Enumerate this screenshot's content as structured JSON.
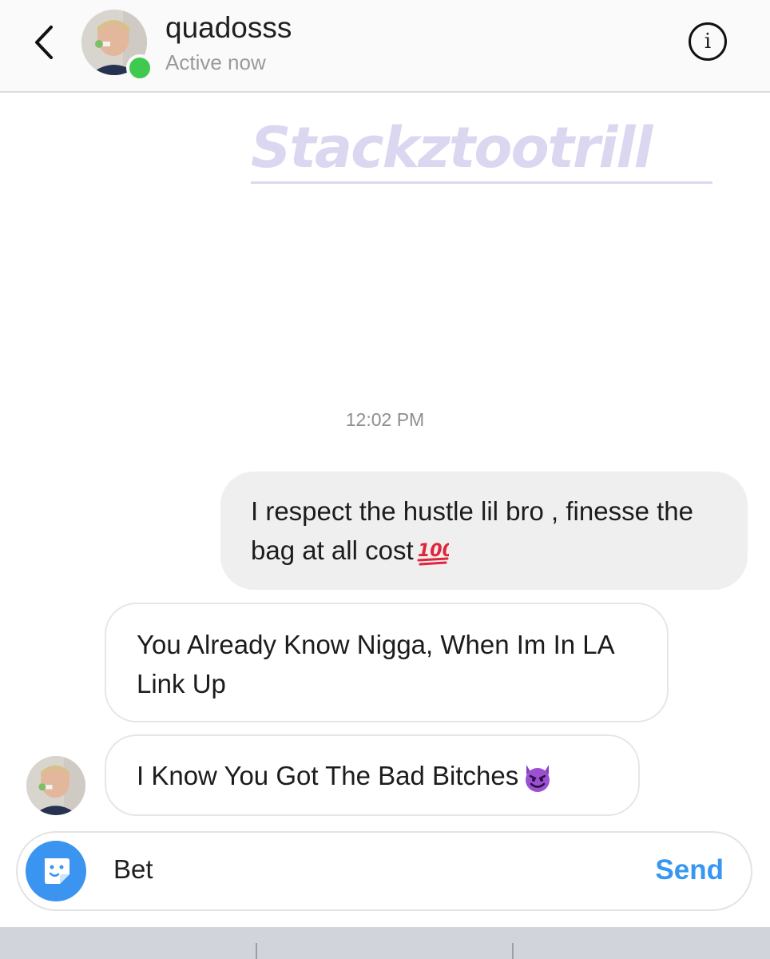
{
  "header": {
    "username": "quadosss",
    "status": "Active now",
    "back_icon": "chevron-left-icon",
    "info_icon": "info-icon",
    "info_glyph": "i"
  },
  "watermark": {
    "text": "Stackztootrill"
  },
  "thread": {
    "timestamp": "12:02 PM",
    "messages": [
      {
        "direction": "sent",
        "text": "I respect the hustle lil bro , finesse the bag at all cost",
        "emoji": "hundred-points-icon"
      },
      {
        "direction": "received",
        "text": "You Already Know Nigga, When Im In LA Link Up"
      },
      {
        "direction": "received",
        "text": "I Know You Got The Bad Bitches",
        "emoji": "smiling-devil-icon"
      }
    ]
  },
  "composer": {
    "value": "Bet",
    "send_label": "Send",
    "sticker_icon": "sticker-icon"
  },
  "colors": {
    "accent": "#3897f0",
    "online": "#3fc94e",
    "sent_bubble": "#efefef",
    "watermark": "#dcd7f0"
  }
}
